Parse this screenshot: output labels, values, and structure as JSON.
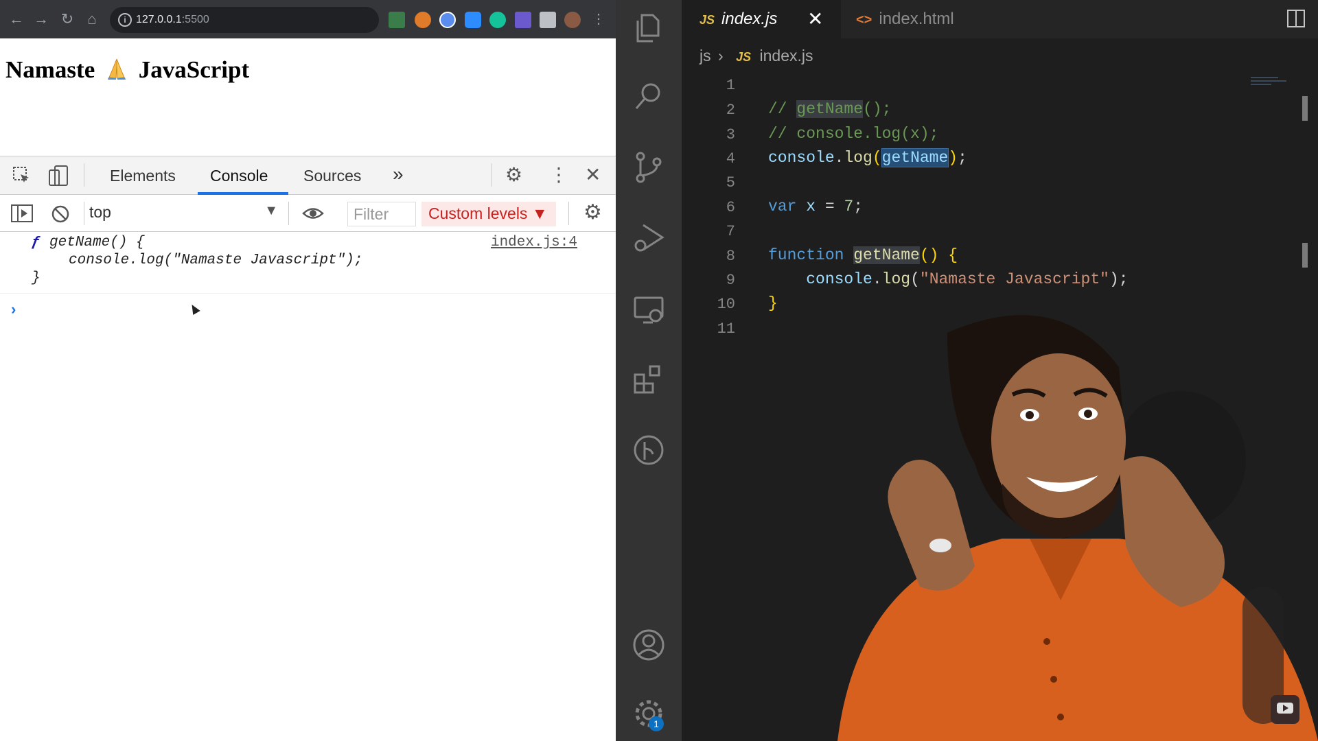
{
  "browser": {
    "url_host": "127.0.0.1",
    "url_port": ":5500",
    "page_heading_left": "Namaste",
    "page_heading_right": "JavaScript"
  },
  "devtools": {
    "tabs": [
      "Elements",
      "Console",
      "Sources"
    ],
    "more_tabs_label": "»",
    "context": "top",
    "filter_placeholder": "Filter",
    "levels_label": "Custom levels ▼",
    "log": {
      "prefix": "ƒ",
      "line1": "getName() {",
      "line2": "console.log(\"Namaste Javascript\");",
      "line3": "}",
      "source": "index.js:4"
    },
    "prompt": "›"
  },
  "vscode": {
    "tabs": [
      {
        "badge": "JS",
        "label": "index.js",
        "active": true
      },
      {
        "badge": "<>",
        "label": "index.html",
        "active": false
      }
    ],
    "close_glyph": "✕",
    "more_glyph": "···",
    "breadcrumb": {
      "folder": "js",
      "sep": "›",
      "badge": "JS",
      "file": "index.js"
    },
    "line_numbers": [
      "1",
      "2",
      "3",
      "4",
      "5",
      "6",
      "7",
      "8",
      "9",
      "10",
      "11"
    ],
    "settings_badge_count": "1"
  },
  "colors": {
    "accent": "#1a73e8",
    "editor_bg": "#1e1e1e",
    "js_yellow": "#e5c04a"
  },
  "icons": [
    "search-icon",
    "source-control-icon",
    "run-debug-icon",
    "remote-explorer-icon",
    "extensions-icon",
    "git-graph-icon",
    "account-icon",
    "manage-gear-icon"
  ]
}
